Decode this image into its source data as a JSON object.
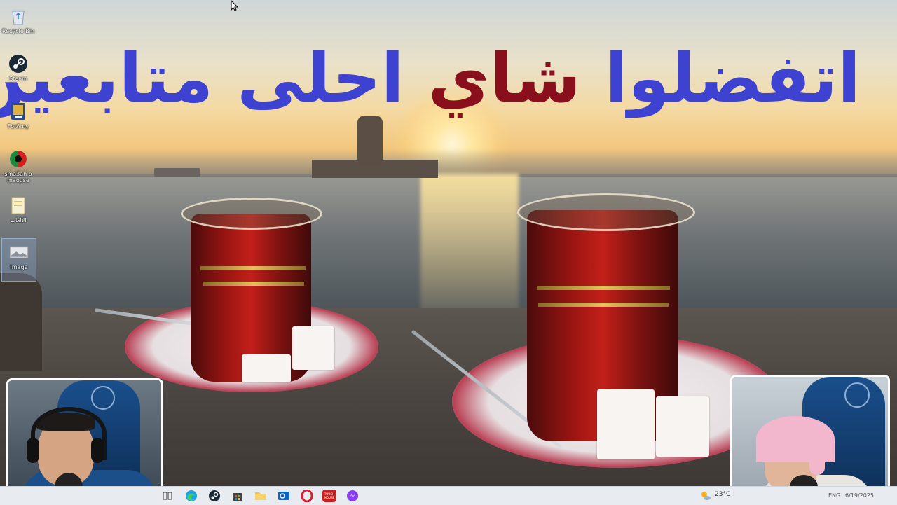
{
  "banner": {
    "word1": "اتفضلوا",
    "word2": "شاي",
    "word3": "احلى",
    "word4": "متابعين",
    "colors": {
      "blue": "#3d42d0",
      "red": "#8a0f1c"
    }
  },
  "desktop_icons": [
    {
      "label": "Recycle Bin",
      "icon": "recycle-bin-icon"
    },
    {
      "label": "Steam",
      "icon": "steam-icon"
    },
    {
      "label": "ForAmy",
      "icon": "app-icon"
    },
    {
      "label": "sma3ah o maouse",
      "icon": "app-icon"
    },
    {
      "label": "الالعاب",
      "icon": "folder-icon"
    },
    {
      "label": "image",
      "icon": "image-file-icon"
    }
  ],
  "taskbar": {
    "apps": [
      {
        "name": "task-view",
        "icon": "task-view-icon"
      },
      {
        "name": "edge",
        "icon": "edge-icon"
      },
      {
        "name": "steam",
        "icon": "steam-icon"
      },
      {
        "name": "store",
        "icon": "store-icon"
      },
      {
        "name": "file-explorer",
        "icon": "folder-icon"
      },
      {
        "name": "outlook",
        "icon": "mail-icon"
      },
      {
        "name": "opera",
        "icon": "opera-icon"
      },
      {
        "name": "touch-mouse",
        "icon": "touch-mouse-icon",
        "label": "TOUCH MOUSE"
      },
      {
        "name": "messenger",
        "icon": "messenger-icon"
      }
    ],
    "weather_temp": "23°C",
    "tray_label": "ENG",
    "date": "6/19/2025"
  }
}
